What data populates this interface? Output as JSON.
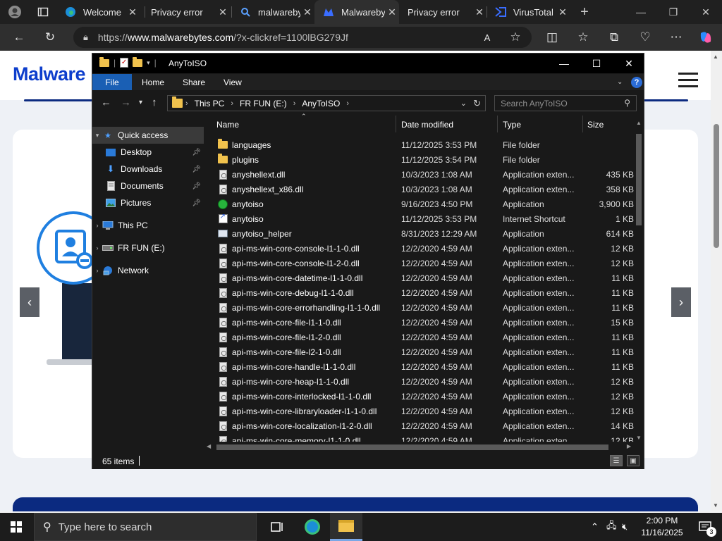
{
  "browser": {
    "tabs": [
      {
        "label": "Welcome",
        "icon": "edge-icon"
      },
      {
        "label": "Privacy error",
        "icon": "warning-icon"
      },
      {
        "label": "malwareby",
        "icon": "search-icon"
      },
      {
        "label": "Malwareby",
        "icon": "malwarebytes-icon"
      },
      {
        "label": "Privacy error",
        "icon": "warning-icon"
      },
      {
        "label": "VirusTotal",
        "icon": "virustotal-icon"
      }
    ],
    "new_tab_label": "+",
    "address": {
      "prefix": "https://",
      "host": "www.malwarebytes.com",
      "path": "/?x-clickref=1100lBG279Jf"
    }
  },
  "site": {
    "logo_text": "Malware"
  },
  "explorer": {
    "title": "AnyToISO",
    "ribbon_tabs": [
      "File",
      "Home",
      "Share",
      "View"
    ],
    "breadcrumb": [
      "This PC",
      "FR FUN (E:)",
      "AnyToISO"
    ],
    "search_placeholder": "Search AnyToISO",
    "nav": {
      "quick_access": "Quick access",
      "desktop": "Desktop",
      "downloads": "Downloads",
      "documents": "Documents",
      "pictures": "Pictures",
      "this_pc": "This PC",
      "drive": "FR FUN (E:)",
      "network": "Network"
    },
    "columns": {
      "name": "Name",
      "date": "Date modified",
      "type": "Type",
      "size": "Size"
    },
    "files": [
      {
        "name": "languages",
        "date": "11/12/2025 3:53 PM",
        "type": "File folder",
        "size": "",
        "icon": "folder"
      },
      {
        "name": "plugins",
        "date": "11/12/2025 3:54 PM",
        "type": "File folder",
        "size": "",
        "icon": "folder"
      },
      {
        "name": "anyshellext.dll",
        "date": "10/3/2023 1:08 AM",
        "type": "Application exten...",
        "size": "435 KB",
        "icon": "dll"
      },
      {
        "name": "anyshellext_x86.dll",
        "date": "10/3/2023 1:08 AM",
        "type": "Application exten...",
        "size": "358 KB",
        "icon": "dll"
      },
      {
        "name": "anytoiso",
        "date": "9/16/2023 4:50 PM",
        "type": "Application",
        "size": "3,900 KB",
        "icon": "app"
      },
      {
        "name": "anytoiso",
        "date": "11/12/2025 3:53 PM",
        "type": "Internet Shortcut",
        "size": "1 KB",
        "icon": "shortcut"
      },
      {
        "name": "anytoiso_helper",
        "date": "8/31/2023 12:29 AM",
        "type": "Application",
        "size": "614 KB",
        "icon": "helper"
      },
      {
        "name": "api-ms-win-core-console-l1-1-0.dll",
        "date": "12/2/2020 4:59 AM",
        "type": "Application exten...",
        "size": "12 KB",
        "icon": "dll"
      },
      {
        "name": "api-ms-win-core-console-l1-2-0.dll",
        "date": "12/2/2020 4:59 AM",
        "type": "Application exten...",
        "size": "12 KB",
        "icon": "dll"
      },
      {
        "name": "api-ms-win-core-datetime-l1-1-0.dll",
        "date": "12/2/2020 4:59 AM",
        "type": "Application exten...",
        "size": "11 KB",
        "icon": "dll"
      },
      {
        "name": "api-ms-win-core-debug-l1-1-0.dll",
        "date": "12/2/2020 4:59 AM",
        "type": "Application exten...",
        "size": "11 KB",
        "icon": "dll"
      },
      {
        "name": "api-ms-win-core-errorhandling-l1-1-0.dll",
        "date": "12/2/2020 4:59 AM",
        "type": "Application exten...",
        "size": "11 KB",
        "icon": "dll"
      },
      {
        "name": "api-ms-win-core-file-l1-1-0.dll",
        "date": "12/2/2020 4:59 AM",
        "type": "Application exten...",
        "size": "15 KB",
        "icon": "dll"
      },
      {
        "name": "api-ms-win-core-file-l1-2-0.dll",
        "date": "12/2/2020 4:59 AM",
        "type": "Application exten...",
        "size": "11 KB",
        "icon": "dll"
      },
      {
        "name": "api-ms-win-core-file-l2-1-0.dll",
        "date": "12/2/2020 4:59 AM",
        "type": "Application exten...",
        "size": "11 KB",
        "icon": "dll"
      },
      {
        "name": "api-ms-win-core-handle-l1-1-0.dll",
        "date": "12/2/2020 4:59 AM",
        "type": "Application exten...",
        "size": "11 KB",
        "icon": "dll"
      },
      {
        "name": "api-ms-win-core-heap-l1-1-0.dll",
        "date": "12/2/2020 4:59 AM",
        "type": "Application exten...",
        "size": "12 KB",
        "icon": "dll"
      },
      {
        "name": "api-ms-win-core-interlocked-l1-1-0.dll",
        "date": "12/2/2020 4:59 AM",
        "type": "Application exten...",
        "size": "12 KB",
        "icon": "dll"
      },
      {
        "name": "api-ms-win-core-libraryloader-l1-1-0.dll",
        "date": "12/2/2020 4:59 AM",
        "type": "Application exten...",
        "size": "12 KB",
        "icon": "dll"
      },
      {
        "name": "api-ms-win-core-localization-l1-2-0.dll",
        "date": "12/2/2020 4:59 AM",
        "type": "Application exten...",
        "size": "14 KB",
        "icon": "dll"
      },
      {
        "name": "api-ms-win-core-memory-l1-1-0.dll",
        "date": "12/2/2020 4:59 AM",
        "type": "Application exten...",
        "size": "12 KB",
        "icon": "dll"
      }
    ],
    "status_count": "65 items"
  },
  "taskbar": {
    "search_placeholder": "Type here to search",
    "time": "2:00 PM",
    "date": "11/16/2025",
    "notification_count": "3"
  }
}
